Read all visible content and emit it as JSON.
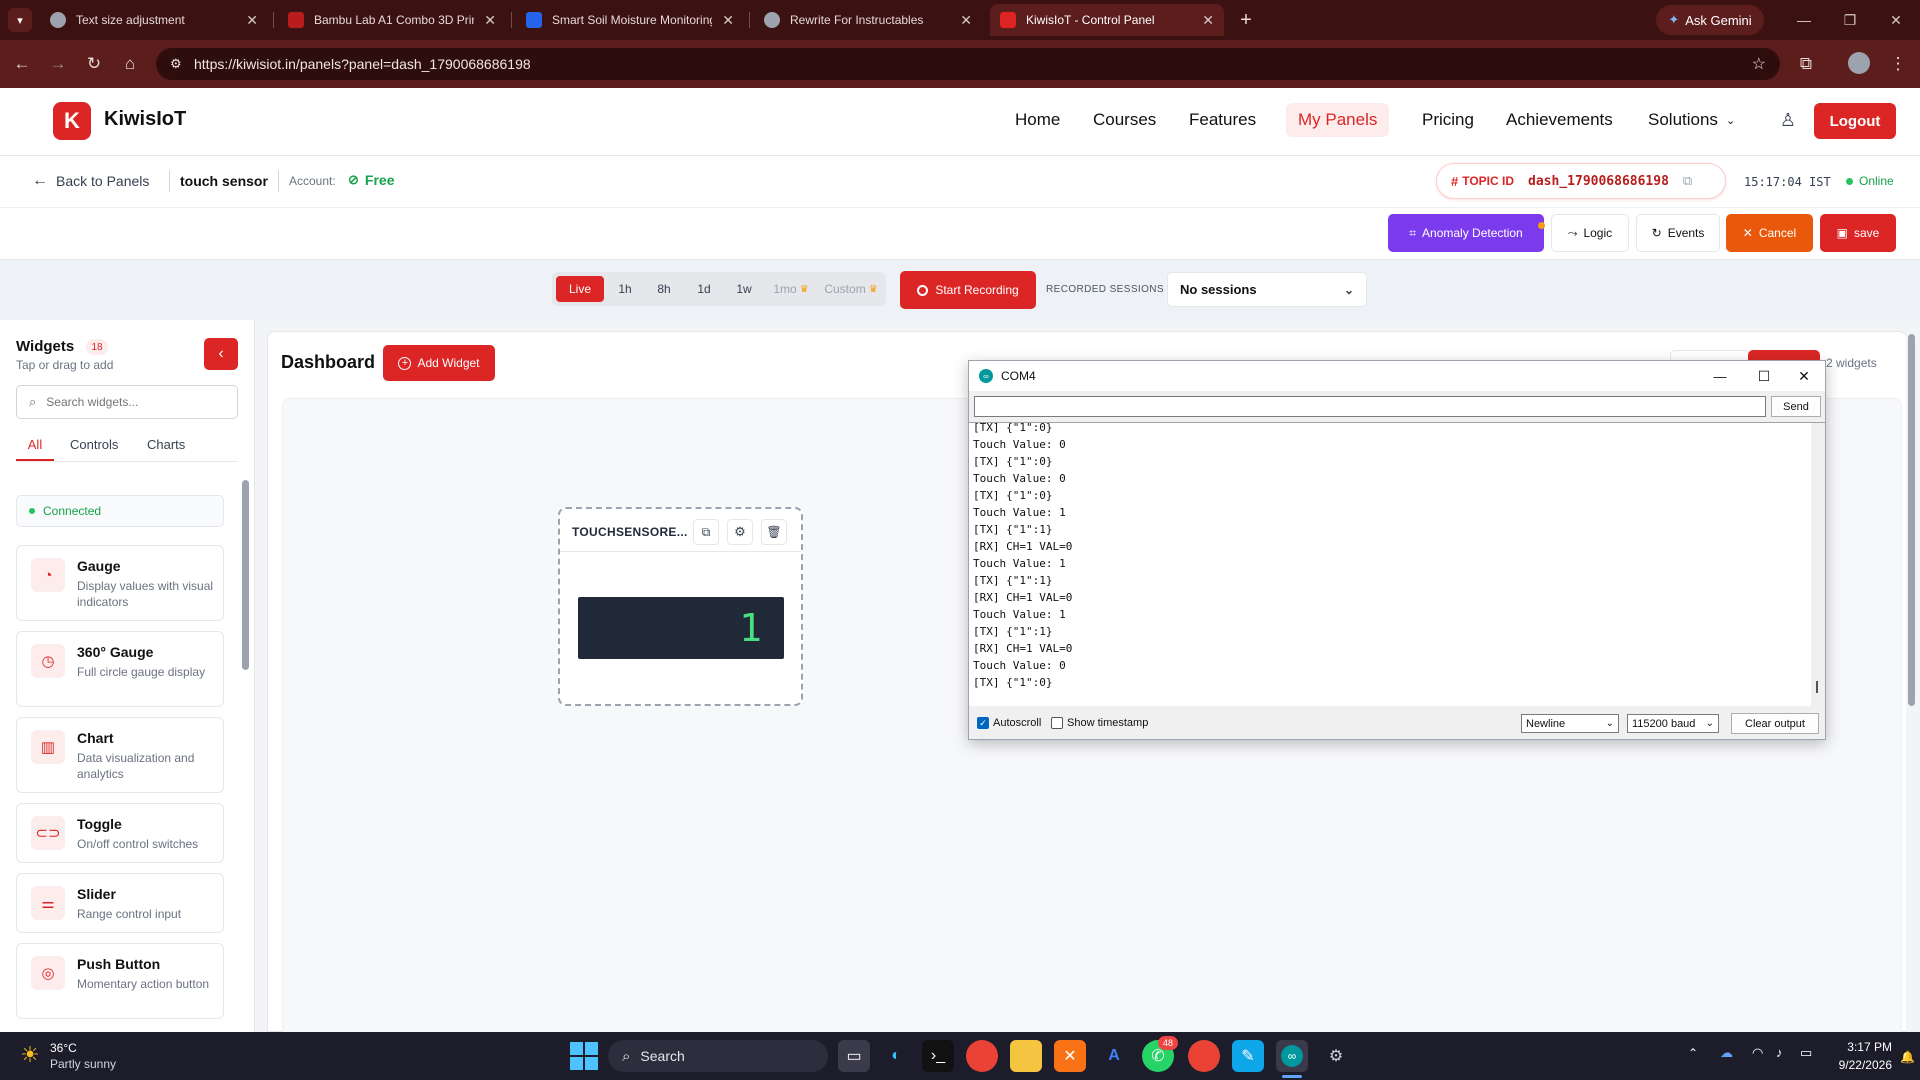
{
  "browser": {
    "tabs": [
      {
        "title": "Text size adjustment",
        "color": "#9ca3af"
      },
      {
        "title": "Bambu Lab A1 Combo 3D Printer",
        "color": "#b91c1c"
      },
      {
        "title": "Smart Soil Moisture Monitoring",
        "color": "#2563eb"
      },
      {
        "title": "Rewrite For Instructables",
        "color": "#9ca3af"
      },
      {
        "title": "KiwisIoT - Control Panel",
        "color": "#dc2626"
      }
    ],
    "gemini": "Ask Gemini",
    "url": "https://kiwisiot.in/panels?panel=dash_1790068686198"
  },
  "app": {
    "brand": "KiwisIoT",
    "nav": [
      "Home",
      "Courses",
      "Features",
      "My Panels",
      "Pricing",
      "Achievements",
      "Solutions"
    ],
    "logout": "Logout",
    "back": "Back to Panels",
    "panel_name": "touch sensor",
    "account_label": "Account:",
    "account_plan": "Free",
    "topic_label": "TOPIC ID",
    "topic_id": "dash_1790068686198",
    "time": "15:17:04 IST",
    "status": "Online"
  },
  "toolbar": {
    "anomaly": "Anomaly Detection",
    "logic": "Logic",
    "events": "Events",
    "cancel": "Cancel",
    "save": "save"
  },
  "timebar": {
    "ranges": [
      "Live",
      "1h",
      "8h",
      "1d",
      "1w",
      "1mo",
      "Custom"
    ],
    "record": "Start Recording",
    "sessions_label": "RECORDED SESSIONS",
    "sessions_value": "No sessions"
  },
  "sidebar": {
    "title": "Widgets",
    "count": "18",
    "subtitle": "Tap or drag to add",
    "search_placeholder": "Search widgets...",
    "tabs": [
      "All",
      "Controls",
      "Charts"
    ],
    "connection": "Connected",
    "widgets": [
      {
        "title": "Gauge",
        "desc": "Display values with visual indicators"
      },
      {
        "title": "360° Gauge",
        "desc": "Full circle gauge display"
      },
      {
        "title": "Chart",
        "desc": "Data visualization and analytics"
      },
      {
        "title": "Toggle",
        "desc": "On/off control switches"
      },
      {
        "title": "Slider",
        "desc": "Range control input"
      },
      {
        "title": "Push Button",
        "desc": "Momentary action button"
      }
    ]
  },
  "dashboard": {
    "title": "Dashboard",
    "add_widget": "Add Widget",
    "widget_count": "2 widgets",
    "widget": {
      "title": "TOUCHSENSORE...",
      "value": "1"
    }
  },
  "serial_monitor": {
    "title": "COM4",
    "send": "Send",
    "lines": [
      "[TX] {\"1\":0}",
      "Touch Value: 0",
      "[TX] {\"1\":0}",
      "Touch Value: 0",
      "[TX] {\"1\":0}",
      "Touch Value: 1",
      "[TX] {\"1\":1}",
      "[RX] CH=1 VAL=0",
      "Touch Value: 1",
      "[TX] {\"1\":1}",
      "[RX] CH=1 VAL=0",
      "Touch Value: 1",
      "[TX] {\"1\":1}",
      "[RX] CH=1 VAL=0",
      "Touch Value: 0",
      "[TX] {\"1\":0}"
    ],
    "autoscroll": "Autoscroll",
    "timestamp": "Show timestamp",
    "line_ending": "Newline",
    "baud": "115200 baud",
    "clear": "Clear output"
  },
  "taskbar": {
    "temp": "36°C",
    "weather": "Partly sunny",
    "search": "Search",
    "badge": "48",
    "time": "3:17 PM",
    "date": "9/22/2026"
  }
}
